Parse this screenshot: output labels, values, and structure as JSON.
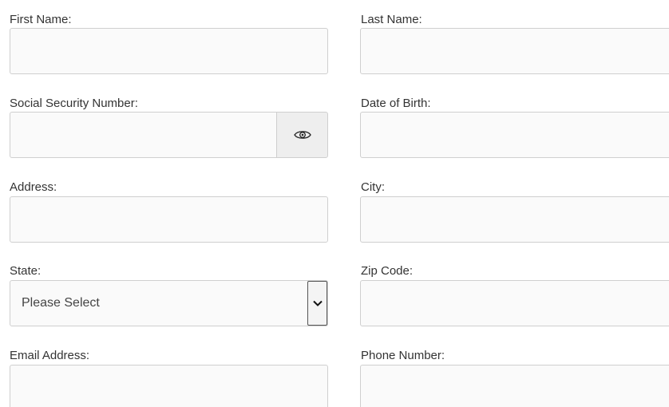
{
  "form": {
    "first_name": {
      "label": "First Name:",
      "value": "",
      "placeholder": ""
    },
    "last_name": {
      "label": "Last Name:",
      "value": "",
      "placeholder": ""
    },
    "ssn": {
      "label": "Social Security Number:",
      "value": "",
      "placeholder": "",
      "toggle_icon": "eye-icon"
    },
    "dob": {
      "label": "Date of Birth:",
      "value": "",
      "placeholder": ""
    },
    "address": {
      "label": "Address:",
      "value": "",
      "placeholder": ""
    },
    "city": {
      "label": "City:",
      "value": "",
      "placeholder": ""
    },
    "state": {
      "label": "State:",
      "selected": "Please Select",
      "arrow_icon": "chevron-down-icon"
    },
    "zip": {
      "label": "Zip Code:",
      "value": "",
      "placeholder": ""
    },
    "email": {
      "label": "Email Address:",
      "value": "",
      "placeholder": ""
    },
    "phone": {
      "label": "Phone Number:",
      "value": "",
      "placeholder": ""
    }
  },
  "colors": {
    "field_background": "#fafafa",
    "field_border": "#cfcfcf",
    "toggle_background": "#eeeeee",
    "text": "#333333"
  }
}
